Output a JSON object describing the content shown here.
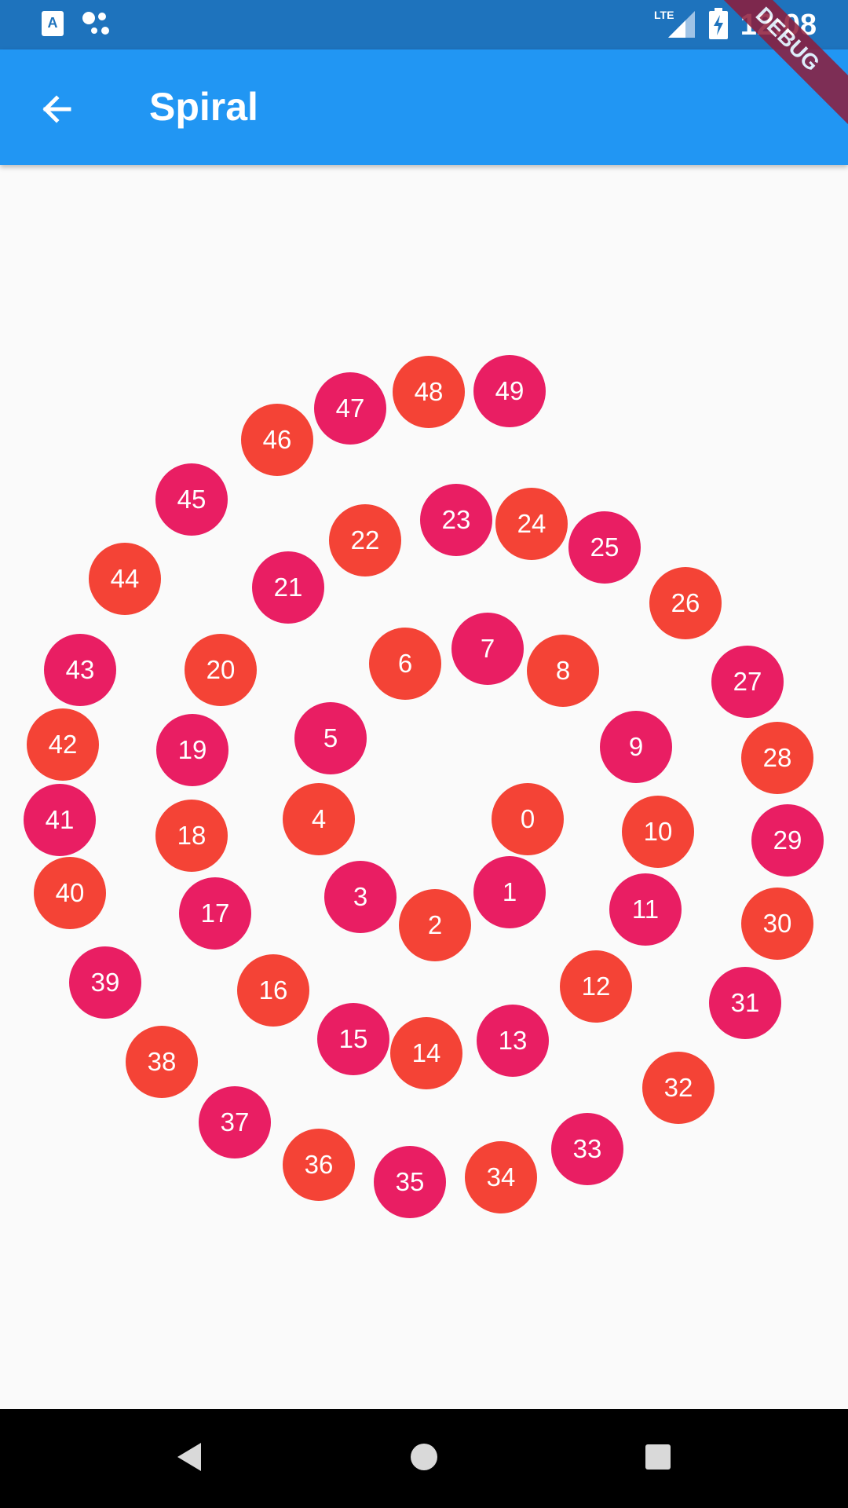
{
  "status_bar": {
    "time": "12:08",
    "network": "LTE"
  },
  "app_bar": {
    "title": "Spiral",
    "back_icon": "arrow-back-icon"
  },
  "debug_banner": {
    "label": "DEBUG"
  },
  "colors": {
    "primary": "#2196f3",
    "status": "#1e73bd",
    "red": "#f44336",
    "pink": "#e91e63",
    "background": "#fafafa"
  },
  "dots": [
    {
      "label": "0",
      "color": "#f44336"
    },
    {
      "label": "1",
      "color": "#e91e63"
    },
    {
      "label": "2",
      "color": "#f44336"
    },
    {
      "label": "3",
      "color": "#e91e63"
    },
    {
      "label": "4",
      "color": "#f44336"
    },
    {
      "label": "5",
      "color": "#e91e63"
    },
    {
      "label": "6",
      "color": "#f44336"
    },
    {
      "label": "7",
      "color": "#e91e63"
    },
    {
      "label": "8",
      "color": "#f44336"
    },
    {
      "label": "9",
      "color": "#e91e63"
    },
    {
      "label": "10",
      "color": "#f44336"
    },
    {
      "label": "11",
      "color": "#e91e63"
    },
    {
      "label": "12",
      "color": "#f44336"
    },
    {
      "label": "13",
      "color": "#e91e63"
    },
    {
      "label": "14",
      "color": "#f44336"
    },
    {
      "label": "15",
      "color": "#e91e63"
    },
    {
      "label": "16",
      "color": "#f44336"
    },
    {
      "label": "17",
      "color": "#e91e63"
    },
    {
      "label": "18",
      "color": "#f44336"
    },
    {
      "label": "19",
      "color": "#e91e63"
    },
    {
      "label": "20",
      "color": "#f44336"
    },
    {
      "label": "21",
      "color": "#e91e63"
    },
    {
      "label": "22",
      "color": "#f44336"
    },
    {
      "label": "23",
      "color": "#e91e63"
    },
    {
      "label": "24",
      "color": "#f44336"
    },
    {
      "label": "25",
      "color": "#e91e63"
    },
    {
      "label": "26",
      "color": "#f44336"
    },
    {
      "label": "27",
      "color": "#e91e63"
    },
    {
      "label": "28",
      "color": "#f44336"
    },
    {
      "label": "29",
      "color": "#e91e63"
    },
    {
      "label": "30",
      "color": "#f44336"
    },
    {
      "label": "31",
      "color": "#e91e63"
    },
    {
      "label": "32",
      "color": "#f44336"
    },
    {
      "label": "33",
      "color": "#e91e63"
    },
    {
      "label": "34",
      "color": "#f44336"
    },
    {
      "label": "35",
      "color": "#e91e63"
    },
    {
      "label": "36",
      "color": "#f44336"
    },
    {
      "label": "37",
      "color": "#e91e63"
    },
    {
      "label": "38",
      "color": "#f44336"
    },
    {
      "label": "39",
      "color": "#e91e63"
    },
    {
      "label": "40",
      "color": "#f44336"
    },
    {
      "label": "41",
      "color": "#e91e63"
    },
    {
      "label": "42",
      "color": "#f44336"
    },
    {
      "label": "43",
      "color": "#e91e63"
    },
    {
      "label": "44",
      "color": "#f44336"
    },
    {
      "label": "45",
      "color": "#e91e63"
    },
    {
      "label": "46",
      "color": "#f44336"
    },
    {
      "label": "47",
      "color": "#e91e63"
    },
    {
      "label": "48",
      "color": "#f44336"
    },
    {
      "label": "49",
      "color": "#e91e63"
    }
  ],
  "nav_bar": {
    "back": "nav-back-icon",
    "home": "nav-home-icon",
    "recents": "nav-recents-icon"
  }
}
